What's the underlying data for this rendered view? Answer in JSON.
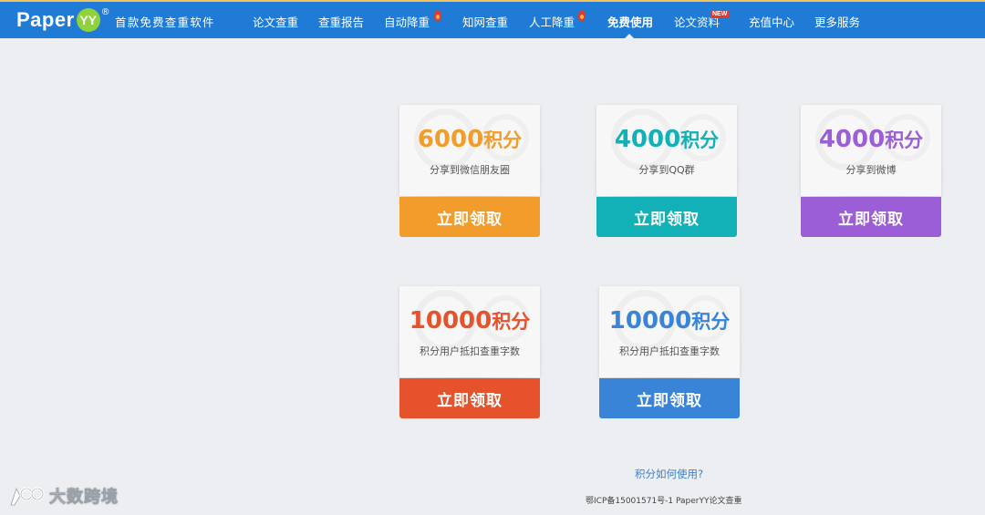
{
  "brand": {
    "logo_text": "Paper",
    "logo_badge": "YY",
    "registered_mark": "®",
    "slogan": "首款免费查重软件"
  },
  "nav": {
    "items": [
      {
        "label": "论文查重"
      },
      {
        "label": "查重报告"
      },
      {
        "label": "自动降重",
        "hot": true
      },
      {
        "label": "知网查重"
      },
      {
        "label": "人工降重",
        "hot": true
      },
      {
        "label": "免费使用",
        "active": true
      },
      {
        "label": "论文资料",
        "badge": "NEW"
      },
      {
        "label": "充值中心"
      },
      {
        "label": "更多服务"
      }
    ]
  },
  "coupons": [
    {
      "points": "6000",
      "unit": "积分",
      "desc": "分享到微信朋友圈",
      "button": "立即领取",
      "color": "#f29c2b"
    },
    {
      "points": "4000",
      "unit": "积分",
      "desc": "分享到QQ群",
      "button": "立即领取",
      "color": "#12b1b8"
    },
    {
      "points": "4000",
      "unit": "积分",
      "desc": "分享到微博",
      "button": "立即领取",
      "color": "#9b5ed6"
    },
    {
      "points": "10000",
      "unit": "积分",
      "desc": "积分用户抵扣查重字数",
      "button": "立即领取",
      "color": "#e5522c"
    },
    {
      "points": "10000",
      "unit": "积分",
      "desc": "积分用户抵扣查重字数",
      "button": "立即领取",
      "color": "#3a84d8"
    }
  ],
  "footer": {
    "help_link": "积分如何使用?",
    "icp": "鄂ICP备15001571号-1 PaperYY论文查重"
  },
  "watermark": {
    "text": "大数跨境"
  },
  "colors": {
    "nav_bg": "#1f7bd6",
    "page_bg": "#eceef2",
    "logo_badge_bg": "#8fd23c"
  }
}
